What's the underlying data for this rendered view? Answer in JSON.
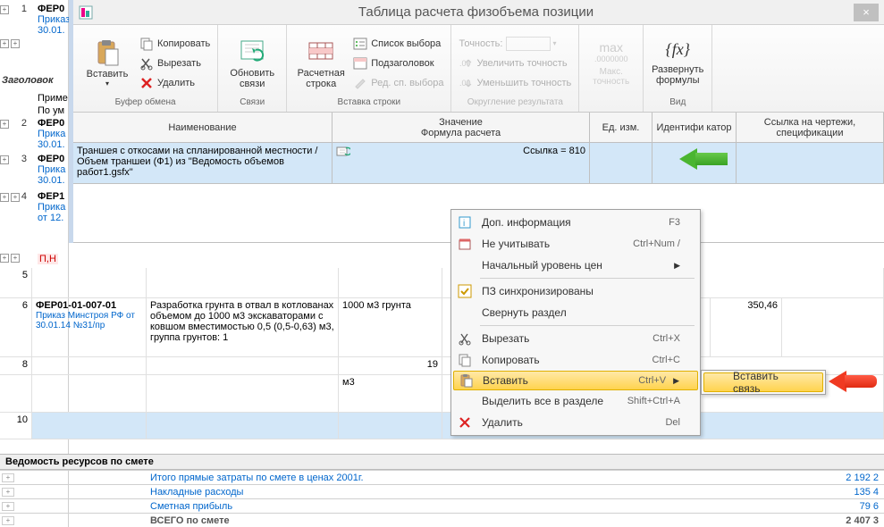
{
  "window": {
    "title": "Таблица расчета физобъема позиции",
    "close": "×"
  },
  "ribbon": {
    "groups": {
      "clipboard": {
        "label": "Буфер обмена",
        "paste": "Вставить",
        "copy": "Копировать",
        "cut": "Вырезать",
        "delete": "Удалить"
      },
      "links": {
        "label": "Связи",
        "refresh": "Обновить связи"
      },
      "insert": {
        "label": "Вставка строки",
        "calcrow": "Расчетная строка",
        "list": "Список выбора",
        "subhead": "Подзаголовок",
        "editlist": "Ред. сп. выбора"
      },
      "round": {
        "label": "Округление результата",
        "precision": "Точность:",
        "inc": "Увеличить точность",
        "dec": "Уменьшить точность"
      },
      "max": {
        "max": "max",
        "zeros": ".0000000",
        "lbl1": "Макс.",
        "lbl2": "точность"
      },
      "view": {
        "label": "Вид",
        "expand": "Развернуть формулы",
        "fx": "{fx}"
      }
    }
  },
  "innergrid": {
    "headers": {
      "name": "Наименование",
      "value": "Значение",
      "formula": "Формула расчета",
      "unit": "Ед. изм.",
      "id": "Идентифи катор",
      "ref": "Ссылка на чертежи, спецификации"
    },
    "row": {
      "name": "Траншея с откосами на спланированной местности / Объем траншеи (Ф1) из \"Ведомость объемов работ1.gsfx\"",
      "value": "Ссылка = 810"
    }
  },
  "leftrows": [
    {
      "num": "1",
      "code": "ФЕР0",
      "sub": "Приказ",
      "date": "30.01."
    },
    {
      "hdr": "Заголовок"
    },
    {
      "txt": "Приме"
    },
    {
      "txt": "По ум"
    },
    {
      "num": "2",
      "code": "ФЕР0",
      "sub": "Прика",
      "date": "30.01."
    },
    {
      "num": "3",
      "code": "ФЕР0",
      "sub": "Прика",
      "date": "30.01."
    },
    {
      "num": "4",
      "code": "ФЕР1",
      "sub": "Прика",
      "date": "от 12."
    },
    {
      "red": "П,Н"
    }
  ],
  "mainrow": {
    "num": "6",
    "code": "ФЕР01-01-007-01",
    "codesub": "Приказ Минстроя РФ от 30.01.14 №31/пр",
    "desc": "Разработка грунта в отвал в котлованах объемом до 1000 м3 экскаваторами с ковшом вместимостью 0,5 (0,5-0,63) м3, группа грунтов: 1",
    "qty": "1000 м3 грунта",
    "price": "350,46"
  },
  "rows": {
    "r5": "5",
    "r8": "8",
    "r8v": "19",
    "r9unit": "м3",
    "r10": "10"
  },
  "context": {
    "items": [
      {
        "icon": "info",
        "label": "Доп. информация",
        "shortcut": "F3"
      },
      {
        "icon": "exclude",
        "label": "Не учитывать",
        "shortcut": "Ctrl+Num /"
      },
      {
        "label": "Начальный уровень цен",
        "sub": true
      },
      {
        "sep": true
      },
      {
        "icon": "check",
        "label": "ПЗ синхронизированы"
      },
      {
        "label": "Свернуть раздел"
      },
      {
        "sep": true
      },
      {
        "icon": "cut",
        "label": "Вырезать",
        "shortcut": "Ctrl+X"
      },
      {
        "icon": "copy",
        "label": "Копировать",
        "shortcut": "Ctrl+C"
      },
      {
        "icon": "paste",
        "label": "Вставить",
        "shortcut": "Ctrl+V",
        "sub": true,
        "hl": true
      },
      {
        "label": "Выделить все в разделе",
        "shortcut": "Shift+Ctrl+A"
      },
      {
        "icon": "del",
        "label": "Удалить",
        "shortcut": "Del"
      }
    ],
    "submenu": "Вставить связь"
  },
  "footer": {
    "header": "Ведомость ресурсов по смете",
    "rows": [
      {
        "label": "Итого прямые затраты по смете в ценах 2001г.",
        "val": "2 192 2"
      },
      {
        "label": "Накладные расходы",
        "val": "135 4"
      },
      {
        "label": "Сметная прибыль",
        "val": "79 6"
      },
      {
        "label": "ВСЕГО по смете",
        "val": "2 407 3",
        "total": true
      }
    ]
  }
}
